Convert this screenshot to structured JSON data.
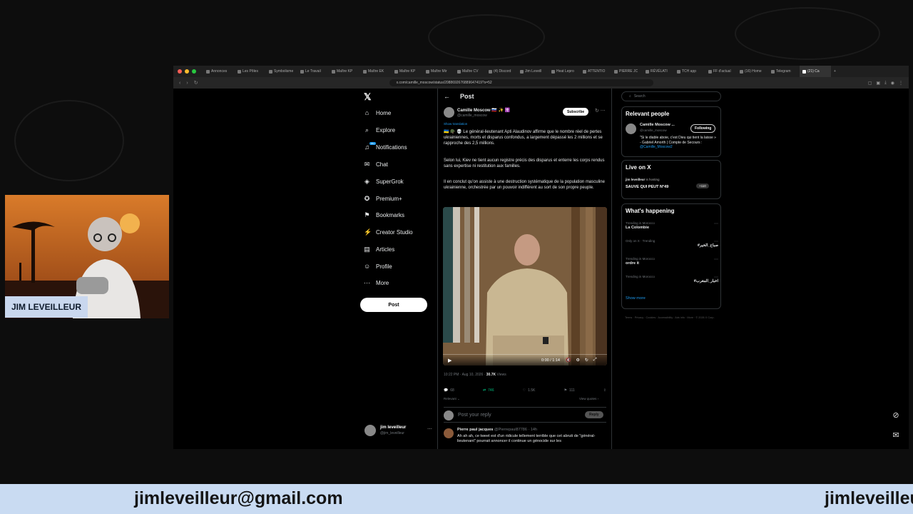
{
  "browser": {
    "tabs": [
      "Annonces",
      "Les Pôles",
      "Symbolisme",
      "Le Travail",
      "Maître KP",
      "Maître EK",
      "Maître KP",
      "Maître Mir",
      "Maître CV",
      "(4) Discord",
      "Jim Leveill",
      "Heat Lepro",
      "ATTENTIO",
      "PIERRE JC",
      "RÉVÉLATI",
      "TCH app",
      "FF d'actual",
      "(16) Home",
      "Telegram",
      "(21) Ca"
    ],
    "url": "x.com/camille_moscow/status/2088692676889647419?s=52"
  },
  "nav": {
    "home": "Home",
    "explore": "Explore",
    "notifications": "Notifications",
    "notif_badge": "20+",
    "chat": "Chat",
    "supergrok": "SuperGrok",
    "premium": "Premium+",
    "bookmarks": "Bookmarks",
    "creator_studio": "Creator Studio",
    "articles": "Articles",
    "profile": "Profile",
    "more": "More",
    "post_button": "Post",
    "account_name": "jim leveilleur",
    "account_handle": "@jim_leveilleur"
  },
  "post": {
    "header": "Post",
    "author_name": "Camille Moscow 🇷🇺 ✨ ☦️",
    "author_handle": "@camille_moscow",
    "subscribe": "Subscribe",
    "show_translation": "Show translation",
    "para1": "🇺🇦 🪖 💀 Le général-lieutenant Apti Alaudinov affirme que le nombre réel de pertes ukrainiennes, morts et disparus confondus, a largement dépassé les 2 millions et se rapproche des 2,5 millions.",
    "para2": "Selon lui, Kiev ne tient aucun registre précis des disparus et enterre les corps rendus sans expertise ni restitution aux familles.",
    "para3": "Il en conclut qu'on assiste à une destruction systématique de la population masculine ukrainienne, orchestrée par un pouvoir indifférent au sort de son propre peuple.",
    "video_time": "0:00 / 1:14",
    "timestamp": "10:22 PM · Aug 10, 2026 · ",
    "views_count": "30.7K",
    "views_label": " Views",
    "replies": "68",
    "reposts": "746",
    "likes": "1.5K",
    "bookmarks": "111",
    "relevant": "Relevant ⌄",
    "view_quotes": "View quotes ›",
    "reply_placeholder": "Post your reply",
    "reply_button": "Reply"
  },
  "comment": {
    "name": "Pierre paul jacques",
    "meta": " @Pierrepaul87786 · 14h",
    "text": "Ah ah ah, ce tweet est d'un ridicule tellement terrible que cet abruti de \"général-lieutenant\" pourrait annoncer il continue un génocide sur les"
  },
  "sidebar": {
    "search_placeholder": "Search",
    "relevant_title": "Relevant people",
    "rp_name": "Camille Moscow ...",
    "rp_handle": "@camille_moscow",
    "rp_follow": "Following",
    "rp_bio": "\"Si le diable aboie, c'est Dieu qui tient la laisse » - Gabriel Amorth | Compte de Secours : ",
    "rp_bio_link": "@Camille_Moscow2",
    "live_title": "Live on X",
    "live_host": "jim leveilleur",
    "live_host_suffix": " is hosting",
    "live_space": "SAUVE QUI PEUT N°49",
    "live_count": "+110",
    "happening_title": "What's happening",
    "trends": [
      {
        "context": "Trending in Morocco",
        "name": "La Colombie"
      },
      {
        "context": "Only on X · Trending",
        "name": "#صباح_الخير"
      },
      {
        "context": "Trending in Morocco",
        "name": "ordre it"
      },
      {
        "context": "Trending in Morocco",
        "name": "#اخبار_المغرب"
      }
    ],
    "show_more": "Show more",
    "footer": "Terms · Privacy · Cookies · Accessibility · Ads info · More · © 2026 X Corp."
  },
  "webcam": {
    "label": "JIM LEVEILLEUR"
  },
  "banner": {
    "email": "jimleveilleur@gmail.com",
    "email_partial": "jimleveilleur"
  },
  "colors": {
    "accent": "#1d9bf0",
    "banner": "#c9dbf2",
    "background": "#0d0d0d"
  }
}
